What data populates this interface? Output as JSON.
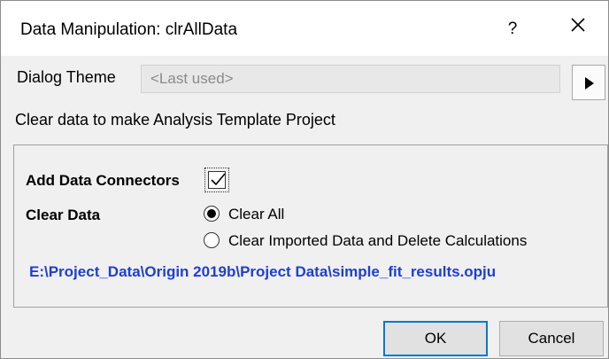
{
  "window": {
    "title": "Data Manipulation: clrAllData",
    "help_label": "?"
  },
  "theme": {
    "label": "Dialog Theme",
    "value": "<Last used>"
  },
  "description": "Clear data to make Analysis Template Project",
  "options": {
    "connectors_label": "Add Data Connectors",
    "connectors_checked": true,
    "clear_label": "Clear Data",
    "radios": [
      {
        "label": "Clear All",
        "selected": true
      },
      {
        "label": "Clear Imported Data and Delete Calculations",
        "selected": false
      }
    ]
  },
  "file_path": "E:\\Project_Data\\Origin 2019b\\Project Data\\simple_fit_results.opju",
  "buttons": {
    "ok": "OK",
    "cancel": "Cancel"
  },
  "colors": {
    "link": "#1f3fd0",
    "focus": "#0078d7",
    "dialog_bg": "#f0f0f0"
  }
}
